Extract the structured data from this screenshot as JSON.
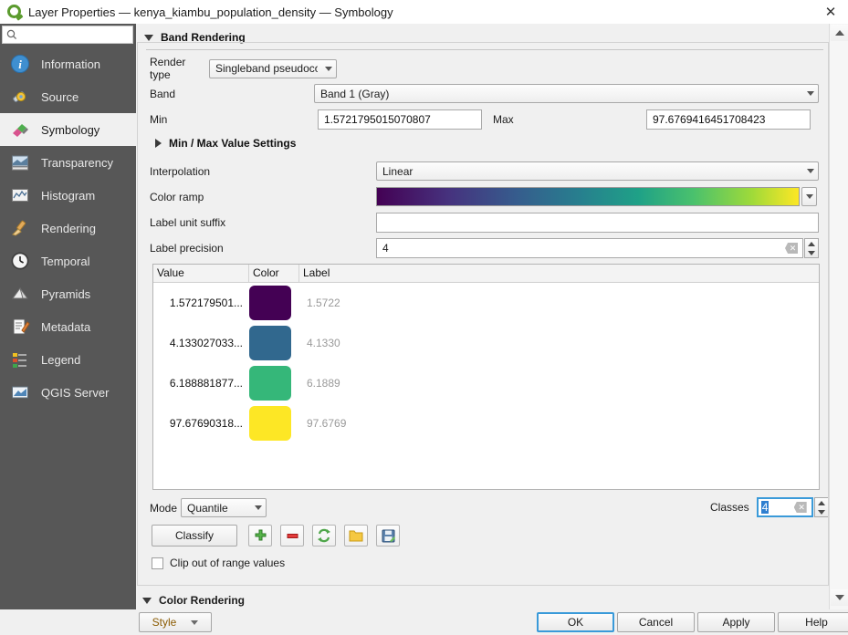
{
  "window": {
    "title": "Layer Properties — kenya_kiambu_population_density — Symbology",
    "app_icon": "qgis-logo-icon",
    "close_label": "✕"
  },
  "sidebar": {
    "search": {
      "placeholder": "",
      "value": "",
      "icon": "search-icon"
    },
    "items": [
      {
        "label": "Information",
        "icon": "information-icon",
        "selected": false
      },
      {
        "label": "Source",
        "icon": "source-icon",
        "selected": false
      },
      {
        "label": "Symbology",
        "icon": "symbology-icon",
        "selected": true
      },
      {
        "label": "Transparency",
        "icon": "transparency-icon",
        "selected": false
      },
      {
        "label": "Histogram",
        "icon": "histogram-icon",
        "selected": false
      },
      {
        "label": "Rendering",
        "icon": "rendering-icon",
        "selected": false
      },
      {
        "label": "Temporal",
        "icon": "clock-icon",
        "selected": false
      },
      {
        "label": "Pyramids",
        "icon": "pyramids-icon",
        "selected": false
      },
      {
        "label": "Metadata",
        "icon": "metadata-icon",
        "selected": false
      },
      {
        "label": "Legend",
        "icon": "legend-icon",
        "selected": false
      },
      {
        "label": "QGIS Server",
        "icon": "qgis-server-icon",
        "selected": false
      }
    ]
  },
  "band_rendering": {
    "section_title": "Band Rendering",
    "render_type": {
      "label": "Render type",
      "value": "Singleband pseudocolor"
    },
    "band": {
      "label": "Band",
      "value": "Band 1 (Gray)"
    },
    "min": {
      "label": "Min",
      "value": "1.5721795015070807"
    },
    "max": {
      "label": "Max",
      "value": "97.6769416451708423"
    },
    "minmax_settings": {
      "label": "Min / Max Value Settings",
      "expanded": false
    },
    "interpolation": {
      "label": "Interpolation",
      "value": "Linear"
    },
    "color_ramp": {
      "label": "Color ramp",
      "value": "Viridis"
    },
    "label_unit_suffix": {
      "label": "Label unit suffix",
      "value": ""
    },
    "label_precision": {
      "label": "Label precision",
      "value": "4"
    },
    "table": {
      "columns": [
        "Value",
        "Color",
        "Label"
      ],
      "rows": [
        {
          "value": "1.572179501...",
          "color": "#440154",
          "label": "1.5722"
        },
        {
          "value": "4.133027033...",
          "color": "#31688e",
          "label": "4.1330"
        },
        {
          "value": "6.188881877...",
          "color": "#35b779",
          "label": "6.1889"
        },
        {
          "value": "97.67690318...",
          "color": "#fde725",
          "label": "97.6769"
        }
      ]
    },
    "mode": {
      "label": "Mode",
      "value": "Quantile"
    },
    "classes": {
      "label": "Classes",
      "value": "4"
    },
    "classify_button": "Classify",
    "tool_buttons": [
      {
        "name": "add-entry-button",
        "icon": "plus-icon"
      },
      {
        "name": "remove-entry-button",
        "icon": "minus-icon"
      },
      {
        "name": "sort-entries-button",
        "icon": "refresh-icon"
      },
      {
        "name": "load-color-map-button",
        "icon": "folder-icon"
      },
      {
        "name": "save-color-map-button",
        "icon": "save-icon"
      }
    ],
    "clip_checkbox": {
      "label": "Clip out of range values",
      "checked": false
    }
  },
  "color_rendering": {
    "section_title": "Color Rendering",
    "expanded": true
  },
  "footer": {
    "style_button": "Style",
    "ok_button": "OK",
    "cancel_button": "Cancel",
    "apply_button": "Apply",
    "help_button": "Help"
  }
}
